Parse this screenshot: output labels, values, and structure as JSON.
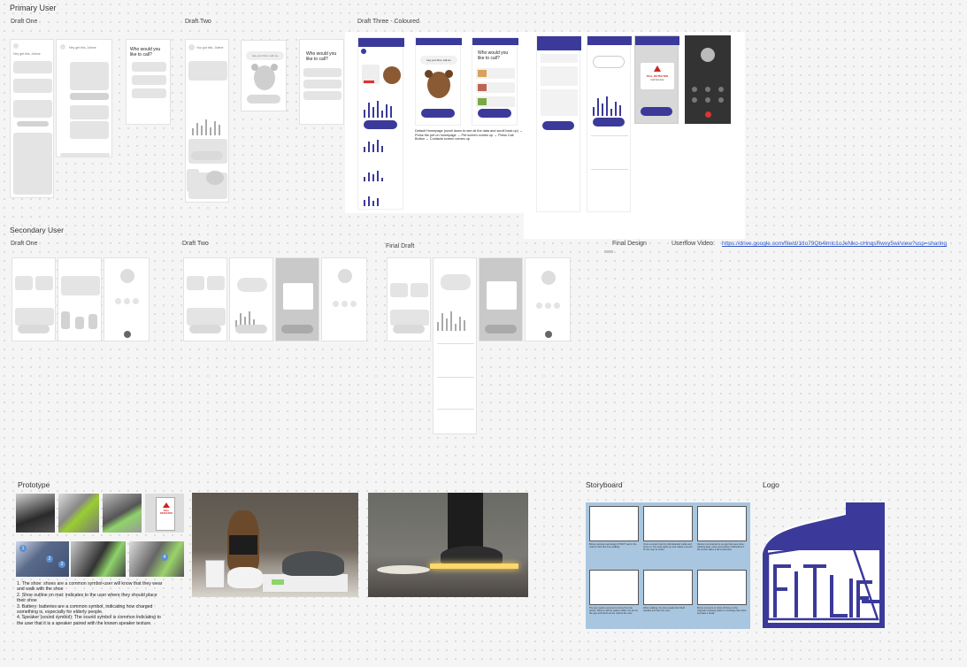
{
  "sections": {
    "primary_user": "Primary User",
    "secondary_user": "Secondary User",
    "prototype": "Prototype",
    "storyboard": "Storyboard",
    "logo": "Logo",
    "final_design": "Final Design"
  },
  "drafts": {
    "p_one": "Draft One",
    "p_two": "Draft Two",
    "p_three": "Draft Three - Coloured",
    "s_one": "Draft One",
    "s_two": "Draft Two",
    "s_final": "Final Draft"
  },
  "userflow": {
    "label": "Userflow Video:",
    "url": "https://drive.google.com/file/d/1tIo79Qb4lmlc1oJeNko-cHnqsRwxy5wi/view?usp=sharing"
  },
  "wireframes": {
    "call_prompt": "Who would you like to call?",
    "call_prompt_colored": "Who would you like to call?",
    "greeting": "Hey you! Don, call me",
    "fall_title": "FALL DETECTED",
    "fall_sub": "Call Services"
  },
  "draft_three_note": "Default Homepage (scroll down to see all the data and scroll back up) → Press the pet on homepage → Pet screen comes up → Press Call Button → Contacts screen comes up",
  "prototype_notes": [
    "1. The shoe: shoes are a common symbol-user will know that they wear and walk with the shoe",
    "2. Shoe outline on mat: indicates to the user where they should place their shoe",
    "3. Battery: batteries are a common symbol, indicating how charged something is, especially for elderly people.",
    "4. Speaker (sound symbol): The sound symbol is common indicating to the user that it is a speaker paired with the known speaker texture."
  ],
  "storyboard_captions": [
    "Binnie receives new design FITLIFT pair in the mail for their first time walking.",
    "Once a sensor has hit a fall detected inside and turns on. The shoe lights up and makes a sound for the user to notice.",
    "Device is connected to an app that uses shoe-tracking data, notes and pushes notifications if the sensor takes a fall is detected.",
    "The app reads movement coming from the device. When a fall the patient walks, the pet on the app and FitLift sensor notices the user.",
    "When walking, the shoe awaits the FitLift standby and then the user...",
    "Binnie connects to show off shoe on the magnetic charging station to recharge their shoe and take a break."
  ],
  "logo_text": "FITLIFT",
  "colors": {
    "accent": "#3b3a9a",
    "storyboard_bg": "#a8c6e0",
    "link": "#2f55c9"
  }
}
